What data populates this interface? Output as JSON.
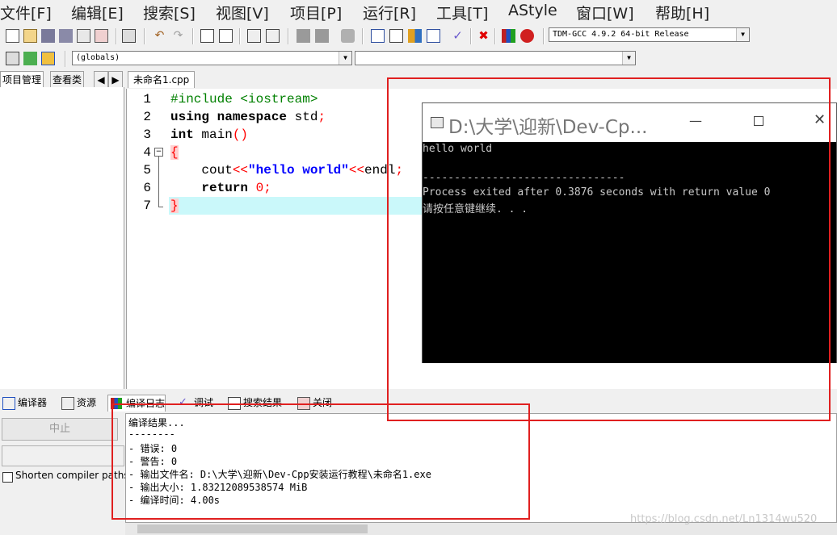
{
  "menu": [
    "文件[F]",
    "编辑[E]",
    "搜索[S]",
    "视图[V]",
    "项目[P]",
    "运行[R]",
    "工具[T]",
    "AStyle",
    "窗口[W]",
    "帮助[H]"
  ],
  "toolbar": {
    "compiler_select": "TDM-GCC 4.9.2 64-bit Release",
    "scope_select": "(globals)",
    "symbol_select": ""
  },
  "left_tabs": {
    "project": "项目管理",
    "classes": "查看类"
  },
  "editor": {
    "tab_label": "未命名1.cpp",
    "lines": [
      {
        "n": "1",
        "text": "#include <iostream>"
      },
      {
        "n": "2",
        "text": "using namespace std;"
      },
      {
        "n": "3",
        "text": "int main()"
      },
      {
        "n": "4",
        "text": "{"
      },
      {
        "n": "5",
        "text": "    cout<<\"hello world\"<<endl;"
      },
      {
        "n": "6",
        "text": "    return 0;"
      },
      {
        "n": "7",
        "text": "}"
      }
    ]
  },
  "console": {
    "title": "D:\\大学\\迎新\\Dev-Cp...",
    "lines": [
      "hello world",
      "",
      "--------------------------------",
      "Process exited after 0.3876 seconds with return value 0",
      "请按任意键继续. . ."
    ]
  },
  "bottom_tabs": [
    "编译器",
    "资源",
    "编译日志",
    "调试",
    "搜索结果",
    "关闭"
  ],
  "bottom_left": {
    "abort_label": "中止",
    "shorten_label": "Shorten compiler paths"
  },
  "log": {
    "lines": [
      "编译结果...",
      "--------",
      "- 错误: 0",
      "- 警告: 0",
      "- 输出文件名: D:\\大学\\迎新\\Dev-Cpp安装运行教程\\未命名1.exe",
      "- 输出大小: 1.83212089538574 MiB",
      "- 编译时间: 4.00s"
    ]
  },
  "watermark": "https://blog.csdn.net/Ln1314wu520",
  "colors": {
    "annotation": "#e02020",
    "highlight_line": "#caf8fa",
    "keyword_green": "#008000",
    "string_blue": "#0000ff",
    "operator_red": "#ff0000"
  }
}
